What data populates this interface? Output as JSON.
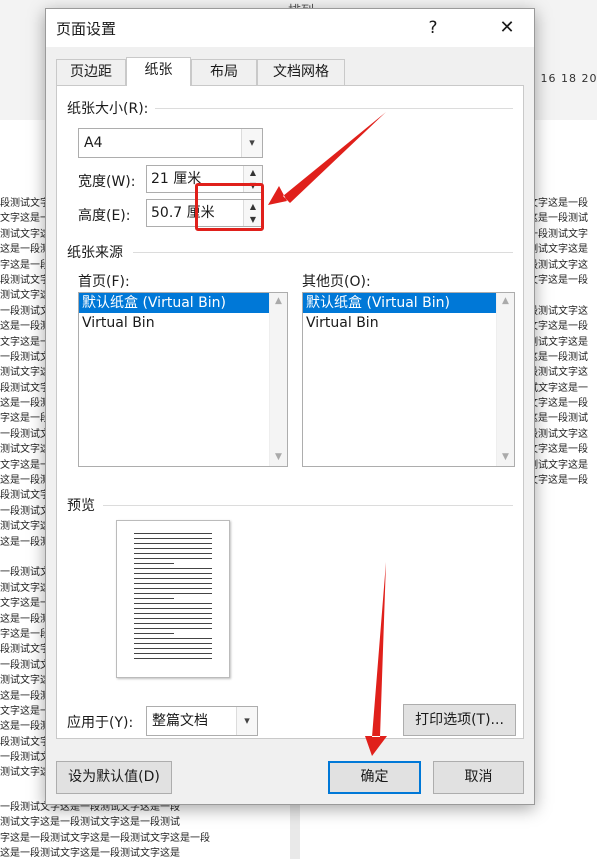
{
  "background": {
    "ribbon_title": "排列",
    "ruler_text": "4 16 18 20",
    "left_lines": [
      "段测试文字这",
      "文字这是一段",
      "测试文字这是",
      "这是一段测试",
      "字这是一段测",
      "段测试文字这",
      "测试文字这是",
      "一段测试文字",
      "这是一段测试",
      "文字这是一段",
      "一段测试文字",
      "测试文字这是",
      "段测试文字这",
      "这是一段测试",
      "字这是一段测",
      "一段测试文字",
      "测试文字这是",
      "文字这是一段",
      "这是一段测试",
      "段测试文字这",
      "一段测试文字",
      "测试文字这是",
      "这是一段测试",
      "",
      "一段测试文字",
      "测试文字这是",
      "文字这是一段",
      "这是一段测试",
      "字这是一段测",
      "段测试文字这",
      "一段测试文字",
      "测试文字这是",
      "这是一段测试",
      "文字这是一段",
      "这是一段测试",
      "段测试文字这",
      "一段测试文字",
      "测试文字这是"
    ],
    "right_lines": [
      "试文字这是一段",
      "字这是一段测试",
      "是一段测试文字",
      "段测试文字这是",
      "一段测试文字这",
      "试文字这是一段",
      "",
      "一段测试文字这",
      "试文字这是一段",
      "段测试文字这是",
      "字这是一段测试",
      "一段测试文字这",
      "测试文字这是一",
      "试文字这是一段",
      "字这是一段测试",
      "一段测试文字这",
      "试文字这是一段",
      "段测试文字这是",
      "试文字这是一段"
    ],
    "bottom_lines": [
      "一段测试文字这是一段测试文字这是一段",
      "测试文字这是一段测试文字这是一段测试",
      "字这是一段测试文字这是一段测试文字这是一段",
      "这是一段测试文字这是一段测试文字这是",
      "一段测试文字这是一段测试文字这是一段"
    ]
  },
  "dialog": {
    "title": "页面设置",
    "help_glyph": "?",
    "close_glyph": "✕",
    "tabs": [
      "页边距",
      "纸张",
      "布局",
      "文档网格"
    ],
    "active_tab": "纸张",
    "paper_size": {
      "label": "纸张大小(R):",
      "value": "A4",
      "width_label": "宽度(W):",
      "width_value": "21 厘米",
      "height_label": "高度(E):",
      "height_value": "50.7 厘米"
    },
    "paper_source": {
      "label": "纸张来源",
      "first_page_label": "首页(F):",
      "other_pages_label": "其他页(O):",
      "first_page_items": [
        "默认纸盒 (Virtual Bin)",
        "Virtual Bin"
      ],
      "other_pages_items": [
        "默认纸盒 (Virtual Bin)",
        "Virtual Bin"
      ],
      "selected_index": 0
    },
    "preview": {
      "label": "预览",
      "apply_label": "应用于(Y):",
      "apply_value": "整篇文档"
    },
    "buttons": {
      "print_options": "打印选项(T)...",
      "set_default": "设为默认值(D)",
      "ok": "确定",
      "cancel": "取消"
    }
  },
  "colors": {
    "accent": "#0078d7",
    "annotation": "#e0201b"
  },
  "icons": {
    "combo_arrow": "chevron-down-icon",
    "spin_up": "triangle-up-icon",
    "spin_down": "triangle-down-icon"
  }
}
